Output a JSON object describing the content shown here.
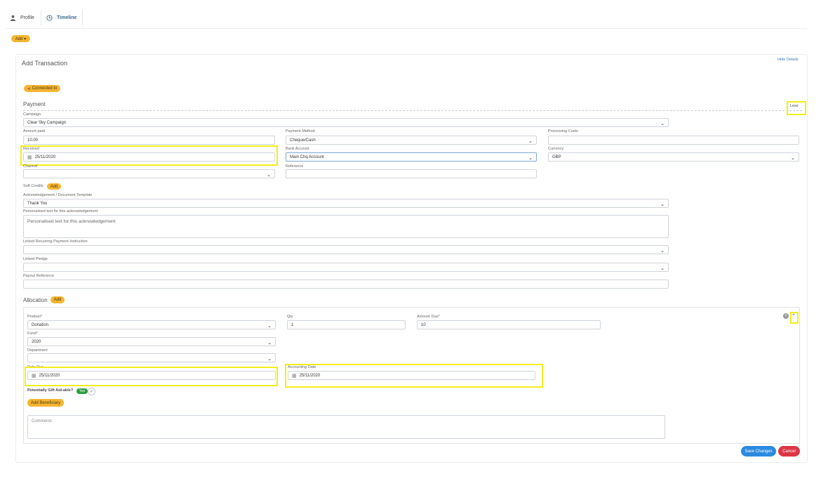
{
  "tabs": {
    "profile": "Profile",
    "timeline": "Timeline"
  },
  "add_dropdown": "Add ▾",
  "panel_title": "Add Transaction",
  "hide_details": "Hide Details",
  "connected_to": "Connected to",
  "payment": {
    "title": "Payment",
    "less": "Less",
    "campaign_label": "Campaign",
    "campaign_value": "Clear Sky Campaign",
    "amount_label": "Amount paid",
    "amount_value": "10.00",
    "method_label": "Payment Method",
    "method_value": "Cheque/Cash",
    "processing_label": "Processing Costs",
    "processing_value": "",
    "received_label": "Received",
    "received_value": "25/11/2020",
    "bank_label": "Bank Account",
    "bank_value": "Main Chq Account",
    "currency_label": "Currency",
    "currency_value": "GBP",
    "channel_label": "Channel",
    "reference_label": "Reference",
    "soft_credits_label": "Soft Credits",
    "soft_credits_add": "Add",
    "ack_label": "Acknowledgement / Document Template",
    "ack_value": "Thank You",
    "personalised_label": "Personalised text for this acknowledgement",
    "personalised_value": "Personalised text for this acknowledgement",
    "recurring_label": "Linked Recurring Payment Instruction",
    "pledge_label": "Linked Pledge",
    "payout_label": "Payout Reference"
  },
  "allocation": {
    "title": "Allocation",
    "add": "Add",
    "product_label": "Product*",
    "product_value": "Donation",
    "qty_label": "Qty",
    "qty_value": "1",
    "amount_due_label": "Amount Due*",
    "amount_due_value": "10",
    "fund_label": "Fund*",
    "fund_value": "2020",
    "department_label": "Department",
    "date_due_label": "Date Due",
    "date_due_value": "25/11/2020",
    "accounting_label": "Accounting Date",
    "accounting_value": "25/11/2020",
    "gift_aid_label": "Potentially Gift Aid-able?",
    "gift_aid_toggle": "Yes",
    "add_beneficiary": "Add Beneficiary",
    "comments_placeholder": "Comments"
  },
  "footer": {
    "save": "Save Changes",
    "cancel": "Cancel"
  },
  "colors": {
    "accent": "#f5b532",
    "save": "#2a8ae0",
    "cancel": "#dc3545",
    "highlight": "#f3ee1b",
    "toggle": "#2f9e44"
  }
}
